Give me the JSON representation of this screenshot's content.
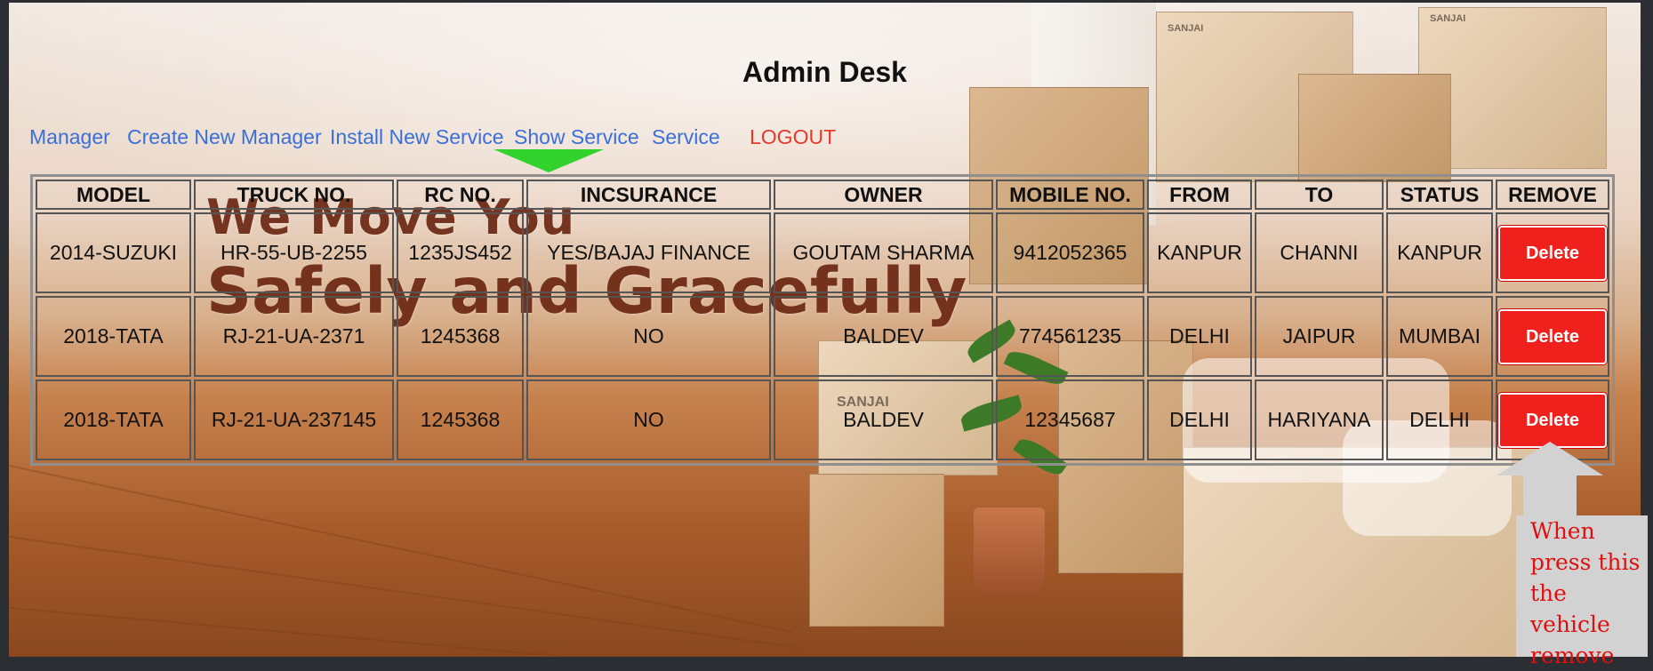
{
  "page": {
    "title": "Admin Desk"
  },
  "nav": {
    "items": [
      {
        "label": "Manager"
      },
      {
        "label": "Create New Manager"
      },
      {
        "label": "Install New Service"
      },
      {
        "label": "Show Service"
      },
      {
        "label": "Service"
      },
      {
        "label": "LOGOUT"
      }
    ]
  },
  "background": {
    "slogan_line1": "We Move You",
    "slogan_line2": "Safely and Gracefully",
    "box_brand": "SANJAI"
  },
  "table": {
    "headers": [
      "MODEL",
      "TRUCK NO.",
      "RC NO.",
      "INCSURANCE",
      "OWNER",
      "MOBILE NO.",
      "FROM",
      "TO",
      "STATUS",
      "REMOVE"
    ],
    "rows": [
      [
        "2014-SUZUKI",
        "HR-55-UB-2255",
        "1235JS452",
        "YES/BAJAJ FINANCE",
        "GOUTAM SHARMA",
        "9412052365",
        "KANPUR",
        "CHANNI",
        "KANPUR"
      ],
      [
        "2018-TATA",
        "RJ-21-UA-2371",
        "1245368",
        "NO",
        "BALDEV",
        "774561235",
        "DELHI",
        "JAIPUR",
        "MUMBAI"
      ],
      [
        "2018-TATA",
        "RJ-21-UA-237145",
        "1245368",
        "NO",
        "BALDEV",
        "12345687",
        "DELHI",
        "HARIYANA",
        "DELHI"
      ]
    ],
    "delete_label": "Delete"
  },
  "annotation": {
    "lines": [
      "When",
      "press this",
      "the vehicle",
      "remove"
    ]
  },
  "colors": {
    "link": "#3b6fd8",
    "logout": "#e53a2a",
    "delete_button": "#f0201d",
    "pointer_arrow": "#32d22c",
    "annotation_text": "#e01010"
  }
}
